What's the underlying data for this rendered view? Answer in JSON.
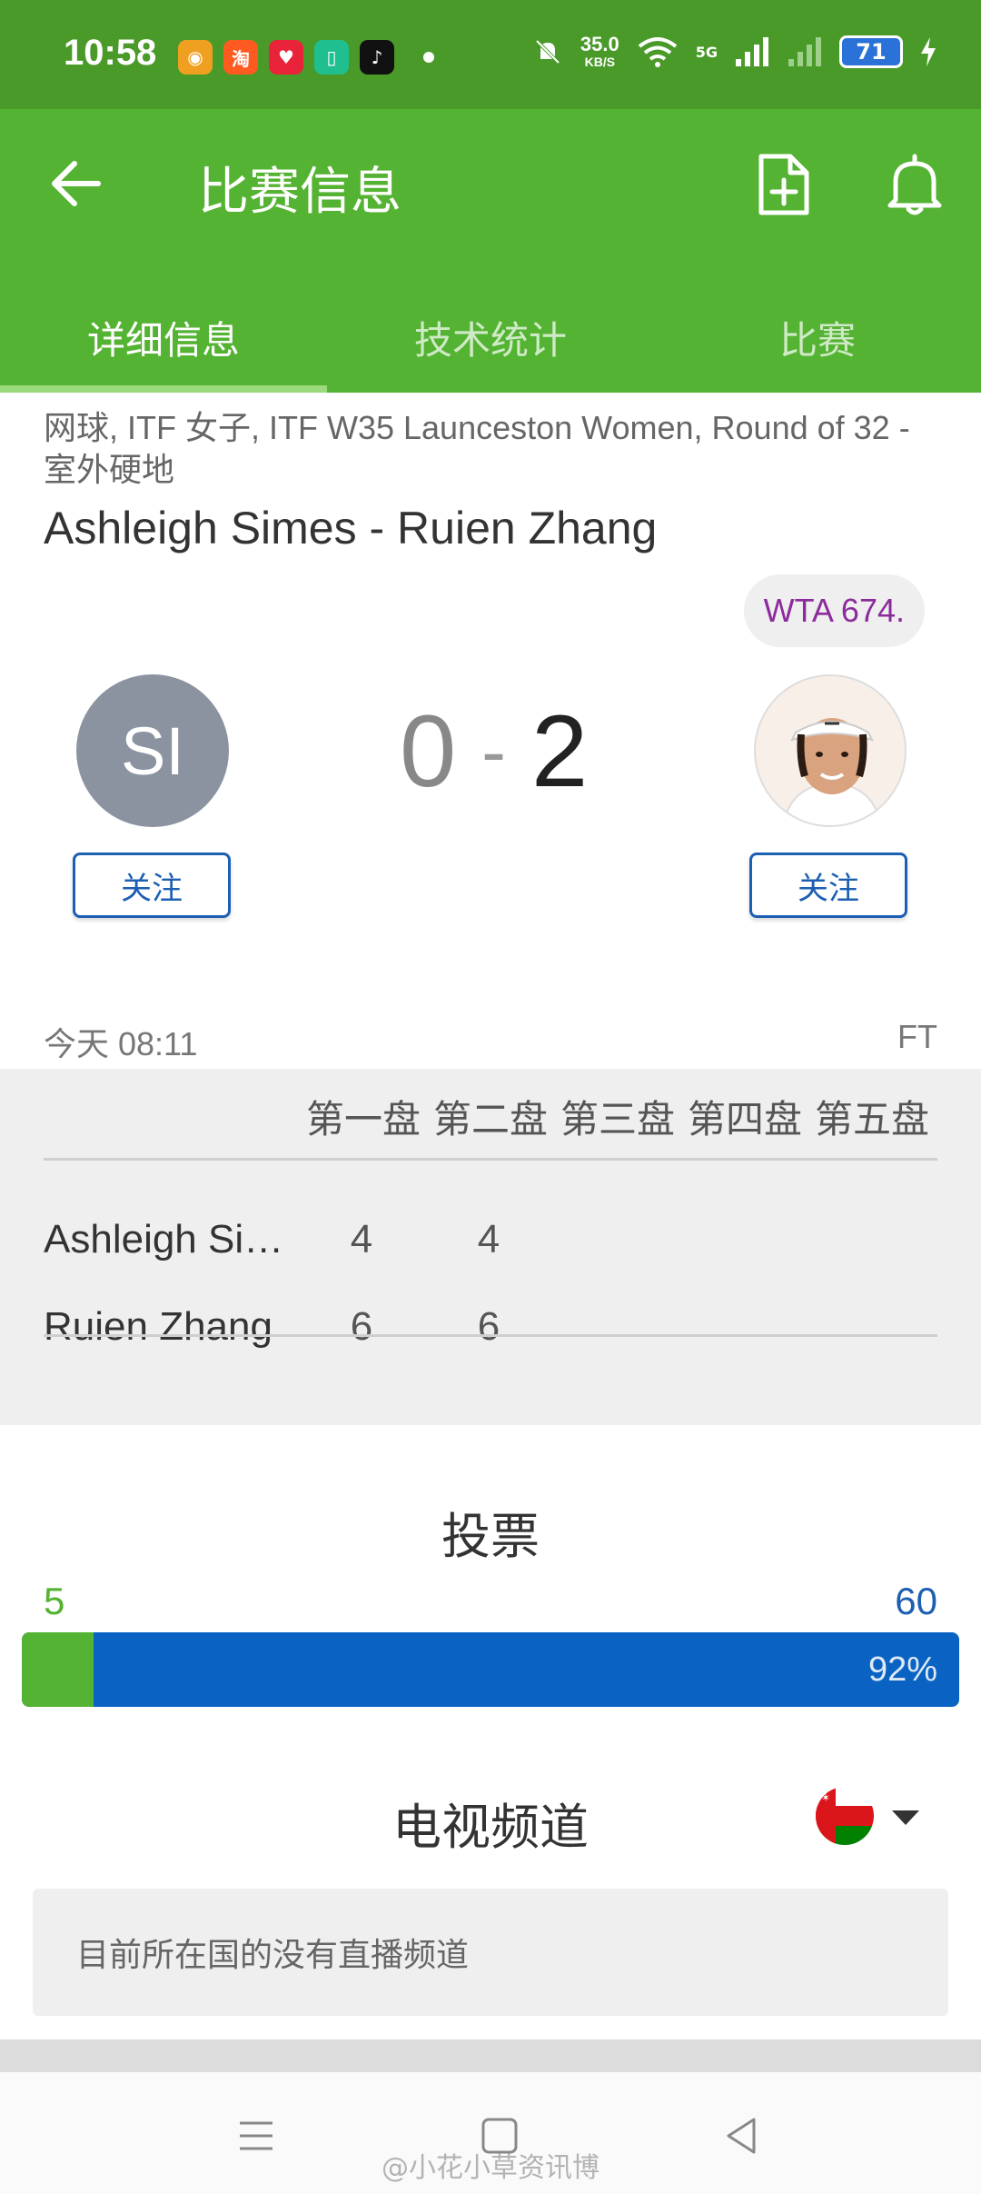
{
  "status_bar": {
    "time": "10:58",
    "net_speed": "35.0",
    "net_unit": "KB/S",
    "network": "5G",
    "battery": "71",
    "notification_icons": [
      "weibo-icon",
      "taobao-icon",
      "heart-app-icon",
      "green-app-icon",
      "tiktok-icon"
    ]
  },
  "app_bar": {
    "title": "比赛信息"
  },
  "tabs": [
    {
      "label": "详细信息"
    },
    {
      "label": "技术统计"
    },
    {
      "label": "比赛"
    }
  ],
  "match": {
    "subtitle": "网球, ITF 女子, ITF W35 Launceston Women, Round of 32 - 室外硬地",
    "title": "Ashleigh Simes - Ruien Zhang",
    "rank_badge": "WTA 674.",
    "left_initials": "SI",
    "score_left": "0",
    "score_sep": "-",
    "score_right": "2",
    "follow_label": "关注",
    "time": "今天 08:11",
    "status": "FT"
  },
  "set_table": {
    "headers": [
      "第一盘",
      "第二盘",
      "第三盘",
      "第四盘",
      "第五盘"
    ],
    "rows": [
      {
        "name": "Ashleigh Sim…",
        "sets": [
          "4",
          "4",
          "",
          "",
          ""
        ]
      },
      {
        "name": "Ruien Zhang",
        "sets": [
          "6",
          "6",
          "",
          "",
          ""
        ]
      }
    ]
  },
  "vote": {
    "title": "投票",
    "left_count": "5",
    "right_count": "60",
    "right_percent_label": "92%",
    "left_fraction": 0.077,
    "left_color": "#54b332",
    "right_color": "#0a63c2"
  },
  "tv": {
    "title": "电视频道",
    "message": "目前所在国的没有直播频道",
    "flag": "oman-flag-icon"
  },
  "watermark": "@小花小草资讯博",
  "colors": {
    "brand_green": "#54b332",
    "status_green": "#4a9a2a",
    "link_blue": "#1d5fb2",
    "rank_purple": "#8b2b9c"
  }
}
